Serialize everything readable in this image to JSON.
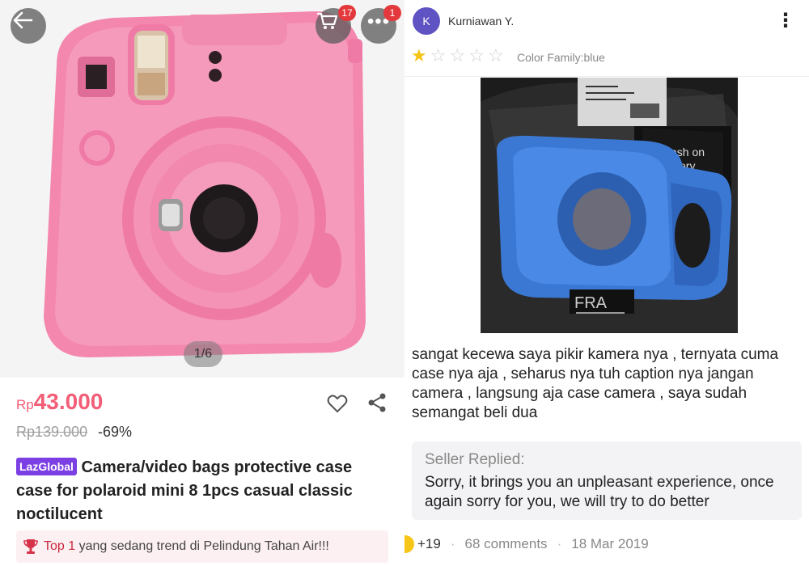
{
  "left": {
    "image_counter": "1/6",
    "cart_badge": "17",
    "more_badge": "1",
    "price_currency": "Rp",
    "price_amount": "43.000",
    "old_price": "Rp139.000",
    "discount": "-69%",
    "brand_tag": "LazGlobal",
    "title": "Camera/video bags protective case case for polaroid mini 8 1pcs casual classic noctilucent",
    "trend_rank": "Top 1",
    "trend_text": "yang sedang trend di Pelindung Tahan Air!!!",
    "icons": [
      "back-arrow-icon",
      "cart-icon",
      "more-icon",
      "heart-icon",
      "share-icon",
      "trophy-icon"
    ],
    "colors": {
      "price": "#f25d77",
      "brand_tag": "#7b3fe4",
      "badge": "#e4393c",
      "trend": "#c9283e"
    }
  },
  "right": {
    "avatar_initial": "K",
    "reviewer_name": "Kurniawan Y.",
    "rating": 1,
    "rating_max": 5,
    "variant": "Color Family:blue",
    "review_text": "sangat kecewa saya pikir kamera nya , ternyata cuma case nya aja , seharus nya tuh caption nya jangan camera , langsung aja case camera , saya sudah semangat beli dua",
    "reply_label": "Seller Replied:",
    "reply_text": "Sorry, it brings you an unpleasant experience, once again sorry for you, we will try to do better",
    "likes": "+19",
    "comments": "68 comments",
    "date": "18 Mar 2019",
    "photo_text_1": "cash on",
    "photo_text_2": "ery",
    "photo_text_3": "FRA",
    "colors": {
      "avatar": "#5f52c2",
      "star_on": "#f5c518",
      "star_off": "#d0d0d0"
    }
  }
}
